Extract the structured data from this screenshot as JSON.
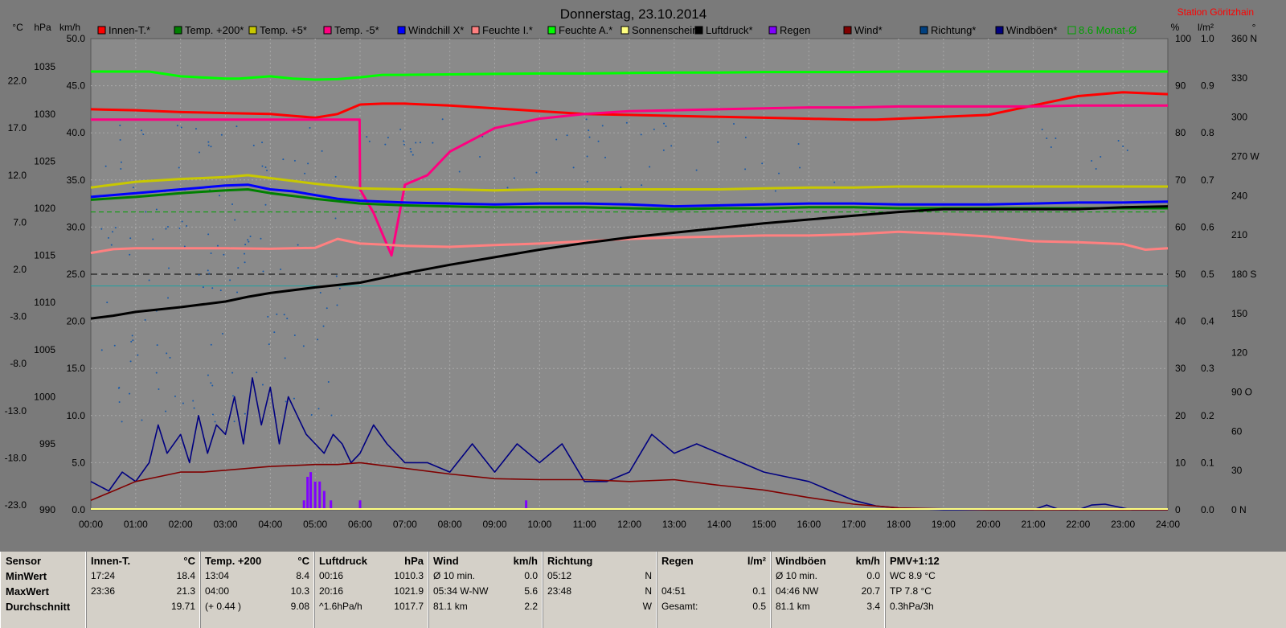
{
  "title": "Donnerstag, 23.10.2014",
  "station": "Station Göritzhain",
  "unit_headers_left": [
    "°C",
    "hPa",
    "km/h"
  ],
  "unit_headers_right": [
    "%",
    "l/m²",
    "°"
  ],
  "legend": [
    {
      "label": "Innen-T.*",
      "color": "#ff0000"
    },
    {
      "label": "Temp. +200*",
      "color": "#008000"
    },
    {
      "label": "Temp. +5*",
      "color": "#c8c800"
    },
    {
      "label": "Temp. -5*",
      "color": "#ff0080"
    },
    {
      "label": "Windchill X*",
      "color": "#0000ff"
    },
    {
      "label": "Feuchte I.*",
      "color": "#ff8080"
    },
    {
      "label": "Feuchte A.*",
      "color": "#00ff00"
    },
    {
      "label": "Sonnenschein",
      "color": "#ffff80"
    },
    {
      "label": "Luftdruck*",
      "color": "#000000"
    },
    {
      "label": "Regen",
      "color": "#8000ff"
    },
    {
      "label": "Wind*",
      "color": "#800000"
    },
    {
      "label": "Richtung*",
      "color": "#004080"
    },
    {
      "label": "Windböen*",
      "color": "#000080"
    },
    {
      "label": "8.6 Monat-Ø",
      "color": "#00a000",
      "hollow": true
    }
  ],
  "chart_data": {
    "type": "line",
    "title": "Donnerstag, 23.10.2014",
    "x_ticks": [
      "00:00",
      "01:00",
      "02:00",
      "03:00",
      "04:00",
      "05:00",
      "06:00",
      "07:00",
      "08:00",
      "09:00",
      "10:00",
      "11:00",
      "12:00",
      "13:00",
      "14:00",
      "15:00",
      "16:00",
      "17:00",
      "18:00",
      "19:00",
      "20:00",
      "21:00",
      "22:00",
      "23:00",
      "24:00"
    ],
    "axes": {
      "temp_c": [
        "22.0",
        "17.0",
        "12.0",
        "7.0",
        "2.0",
        "-3.0",
        "-8.0",
        "-13.0",
        "-18.0",
        "-23.0"
      ],
      "pressure_hpa": [
        "1035",
        "1030",
        "1025",
        "1020",
        "1015",
        "1010",
        "1005",
        "1000",
        "995",
        "990"
      ],
      "wind_kmh": [
        "50.0",
        "45.0",
        "40.0",
        "35.0",
        "30.0",
        "25.0",
        "20.0",
        "15.0",
        "10.0",
        "5.0",
        "0.0"
      ],
      "humidity_pct": [
        "100",
        "90",
        "80",
        "70",
        "60",
        "50",
        "40",
        "30",
        "20",
        "10",
        "0"
      ],
      "rain_lm2": [
        "1.0",
        "0.9",
        "0.8",
        "0.7",
        "0.6",
        "0.5",
        "0.4",
        "0.3",
        "0.2",
        "0.1",
        "0.0"
      ],
      "direction_deg": [
        "360 N",
        "330",
        "300",
        "270 W",
        "240",
        "210",
        "180 S",
        "150",
        "120",
        "90 O",
        "60",
        "30",
        "0 N"
      ]
    },
    "ylim_wind": [
      0,
      50
    ],
    "series": [
      {
        "name": "Innen-T.*",
        "color": "#ff0000",
        "axis": "temp",
        "x": [
          0,
          1,
          2,
          3,
          4,
          4.5,
          5,
          5.5,
          6,
          6.5,
          7,
          8,
          9,
          10,
          11,
          12,
          13,
          14,
          15,
          16,
          17,
          17.5,
          18,
          19,
          20,
          21,
          22,
          23,
          24
        ],
        "y": [
          19.5,
          19.4,
          19.2,
          19.1,
          19.0,
          18.8,
          18.6,
          19.0,
          20.0,
          20.1,
          20.1,
          19.9,
          19.6,
          19.3,
          19.0,
          18.9,
          18.8,
          18.7,
          18.6,
          18.5,
          18.4,
          18.4,
          18.5,
          18.7,
          18.9,
          19.9,
          20.9,
          21.3,
          21.1
        ]
      },
      {
        "name": "Temp. -5*",
        "color": "#ff0080",
        "axis": "temp",
        "x": [
          0,
          1,
          2,
          3,
          4,
          5,
          5.99,
          6,
          6.3,
          6.7,
          7,
          7.5,
          8,
          9,
          10,
          11,
          12,
          13,
          14,
          15,
          16,
          17,
          18,
          19,
          20,
          21,
          22,
          23,
          24
        ],
        "y": [
          18.4,
          18.4,
          18.4,
          18.4,
          18.4,
          18.4,
          18.4,
          11.0,
          8.5,
          4.0,
          11.5,
          12.5,
          15.0,
          17.5,
          18.5,
          19.0,
          19.3,
          19.4,
          19.5,
          19.6,
          19.7,
          19.7,
          19.8,
          19.8,
          19.8,
          19.8,
          19.9,
          19.9,
          19.9
        ]
      },
      {
        "name": "Feuchte A.*",
        "color": "#00ff00",
        "axis": "hum",
        "x": [
          0,
          1,
          1.3,
          2,
          3,
          3.3,
          4,
          4.5,
          5,
          5.5,
          6,
          6.5,
          7,
          8,
          9,
          10,
          11,
          12,
          13,
          14,
          15,
          16,
          17,
          18,
          19,
          20,
          21,
          22,
          23,
          24
        ],
        "y": [
          93,
          93,
          93,
          92,
          91.5,
          91.5,
          92,
          91.5,
          91.3,
          91.4,
          91.8,
          92.3,
          92.3,
          92.4,
          92.5,
          92.6,
          92.6,
          92.7,
          92.8,
          92.8,
          92.9,
          92.9,
          92.9,
          93,
          93,
          93,
          93,
          93,
          93,
          93
        ]
      },
      {
        "name": "Temp. +5*",
        "color": "#c8c800",
        "axis": "wind",
        "x": [
          0,
          1,
          2,
          3,
          3.5,
          4,
          5,
          6,
          7,
          8,
          9,
          10,
          11,
          12,
          13,
          14,
          15,
          16,
          17,
          18,
          19,
          20,
          21,
          22,
          23,
          24
        ],
        "y": [
          34.2,
          34.8,
          35.1,
          35.3,
          35.5,
          35.2,
          34.6,
          34.1,
          34.0,
          34.0,
          33.9,
          34.0,
          34.0,
          34.0,
          34.0,
          34.0,
          34.1,
          34.2,
          34.2,
          34.3,
          34.3,
          34.3,
          34.3,
          34.3,
          34.3,
          34.3
        ]
      },
      {
        "name": "Windchill X*",
        "color": "#0000ff",
        "axis": "wind",
        "x": [
          0,
          1,
          2,
          3,
          3.5,
          4,
          4.5,
          5,
          5.5,
          6,
          7,
          8,
          9,
          10,
          11,
          12,
          13,
          14,
          15,
          16,
          17,
          18,
          19,
          20,
          21,
          22,
          23,
          24
        ],
        "y": [
          33.2,
          33.6,
          34.0,
          34.4,
          34.5,
          34.0,
          33.8,
          33.4,
          33.0,
          32.8,
          32.6,
          32.5,
          32.4,
          32.5,
          32.5,
          32.4,
          32.2,
          32.3,
          32.4,
          32.5,
          32.5,
          32.4,
          32.4,
          32.4,
          32.5,
          32.6,
          32.6,
          32.7
        ]
      },
      {
        "name": "Temp. +200*",
        "color": "#008000",
        "axis": "wind",
        "x": [
          0,
          1,
          2,
          3,
          3.5,
          4,
          5,
          6,
          7,
          8,
          9,
          10,
          11,
          12,
          13,
          14,
          15,
          16,
          17,
          18,
          19,
          20,
          21,
          22,
          23,
          24
        ],
        "y": [
          32.9,
          33.2,
          33.6,
          33.9,
          34.0,
          33.6,
          33.0,
          32.5,
          32.3,
          32.2,
          32.1,
          32.1,
          32.1,
          32.0,
          31.9,
          32.0,
          32.0,
          32.1,
          32.1,
          32.0,
          32.0,
          32.0,
          32.0,
          32.0,
          32.0,
          32.0
        ]
      },
      {
        "name": "Feuchte I.*",
        "color": "#ff8080",
        "axis": "hum",
        "x": [
          0,
          0.5,
          1,
          2,
          3,
          4,
          5,
          5.5,
          6,
          6.5,
          7,
          8,
          9,
          10,
          11,
          12,
          13,
          14,
          15,
          16,
          17,
          18,
          19,
          20,
          21,
          22,
          23,
          23.5,
          24
        ],
        "y": [
          54.5,
          55.3,
          55.5,
          55.5,
          55.5,
          55.4,
          55.6,
          57.5,
          56.5,
          56.3,
          56.0,
          55.8,
          56.2,
          56.5,
          57.0,
          57.5,
          57.8,
          58,
          58.2,
          58.2,
          58.5,
          59,
          58.6,
          58,
          57,
          56.8,
          56.4,
          55.2,
          55.5
        ]
      },
      {
        "name": "Luftdruck*",
        "color": "#000000",
        "axis": "press",
        "x": [
          0,
          0.5,
          1,
          2,
          3,
          3.5,
          4,
          5,
          6,
          6.5,
          7,
          8,
          9,
          10,
          11,
          12,
          13,
          14,
          15,
          16,
          17,
          18,
          19,
          20,
          21,
          22,
          23,
          24
        ],
        "y": [
          1010.3,
          1010.6,
          1011.0,
          1011.5,
          1012.1,
          1012.6,
          1013.0,
          1013.6,
          1014.1,
          1014.6,
          1015.1,
          1016.0,
          1016.8,
          1017.6,
          1018.3,
          1018.9,
          1019.4,
          1019.9,
          1020.4,
          1020.8,
          1021.2,
          1021.6,
          1021.9,
          1021.9,
          1021.9,
          1021.9,
          1022.1,
          1022.2
        ]
      },
      {
        "name": "Windböen*",
        "color": "#000080",
        "axis": "wind",
        "x": [
          0,
          0.4,
          0.7,
          1,
          1.3,
          1.5,
          1.7,
          2,
          2.2,
          2.4,
          2.6,
          2.8,
          3,
          3.2,
          3.4,
          3.6,
          3.8,
          4,
          4.2,
          4.4,
          4.6,
          4.8,
          5,
          5.2,
          5.4,
          5.6,
          5.8,
          6,
          6.3,
          6.6,
          7,
          7.5,
          8,
          8.5,
          9,
          9.5,
          10,
          10.5,
          11,
          11.5,
          12,
          12.5,
          13,
          13.5,
          14,
          14.5,
          15,
          15.5,
          16,
          16.5,
          17,
          17.5,
          18,
          18.5,
          19,
          20,
          20.5,
          21,
          21.3,
          21.6,
          22,
          22.3,
          22.6,
          22.9,
          23.2,
          23.5,
          24
        ],
        "y": [
          3,
          2,
          4,
          3,
          5,
          9,
          6,
          8,
          5,
          10,
          6,
          9,
          8,
          12,
          7,
          14,
          9,
          13,
          7,
          12,
          10,
          8,
          7,
          6,
          8,
          7,
          5,
          6,
          9,
          7,
          5,
          5,
          4,
          7,
          4,
          7,
          5,
          7,
          3,
          3,
          4,
          8,
          6,
          7,
          6,
          5,
          4,
          3.5,
          3,
          2,
          1,
          0.4,
          0.2,
          0.1,
          0,
          0,
          0,
          0,
          0.5,
          0,
          0,
          0.5,
          0.6,
          0.3,
          0,
          0,
          0
        ]
      },
      {
        "name": "Wind*",
        "color": "#800000",
        "axis": "wind",
        "x": [
          0,
          0.5,
          1,
          1.5,
          2,
          2.5,
          3,
          3.5,
          4,
          4.5,
          5,
          5.5,
          6,
          7,
          8,
          9,
          10,
          11,
          12,
          13,
          14,
          15,
          16,
          17,
          18,
          19,
          20,
          21,
          22,
          23,
          24
        ],
        "y": [
          1,
          2,
          3,
          3.5,
          4,
          4,
          4.2,
          4.4,
          4.6,
          4.7,
          4.8,
          4.8,
          5,
          4.4,
          3.8,
          3.3,
          3.2,
          3.2,
          3,
          3.2,
          2.6,
          2.1,
          1.3,
          0.6,
          0.2,
          0.1,
          0,
          0,
          0,
          0,
          0
        ]
      },
      {
        "name": "Regen",
        "color": "#8000ff",
        "axis": "rain",
        "type": "bar",
        "x": [
          4.75,
          4.83,
          4.9,
          5.0,
          5.1,
          5.2,
          5.35,
          6.0,
          9.7
        ],
        "y": [
          0.02,
          0.07,
          0.08,
          0.06,
          0.06,
          0.04,
          0.02,
          0.02,
          0.02
        ]
      }
    ]
  },
  "stats": {
    "sensor": {
      "title": "Sensor",
      "rows": [
        "MinWert",
        "MaxWert",
        "Durchschnitt"
      ]
    },
    "innen": {
      "title": "Innen-T.",
      "unit": "°C",
      "rows": [
        [
          "17:24",
          "18.4"
        ],
        [
          "23:36",
          "21.3"
        ],
        [
          "",
          "19.71"
        ]
      ]
    },
    "temp200": {
      "title": "Temp. +200",
      "unit": "°C",
      "rows": [
        [
          "13:04",
          "8.4"
        ],
        [
          "04:00",
          "10.3"
        ],
        [
          "(+ 0.44 )",
          "9.08"
        ]
      ]
    },
    "druck": {
      "title": "Luftdruck",
      "unit": "hPa",
      "rows": [
        [
          "00:16",
          "1010.3"
        ],
        [
          "20:16",
          "1021.9"
        ],
        [
          "^1.6hPa/h",
          "1017.7"
        ]
      ]
    },
    "wind": {
      "title": "Wind",
      "unit": "km/h",
      "rows": [
        [
          "Ø 10 min.",
          "0.0"
        ],
        [
          "05:34 W-NW",
          "5.6"
        ],
        [
          "81.1 km",
          "2.2"
        ]
      ]
    },
    "richtung": {
      "title": "Richtung",
      "unit": "",
      "rows": [
        [
          "05:12",
          "N"
        ],
        [
          "23:48",
          "N"
        ],
        [
          "",
          "W"
        ]
      ]
    },
    "regen": {
      "title": "Regen",
      "unit": "l/m²",
      "rows": [
        [
          "",
          ""
        ],
        [
          "04:51",
          "0.1"
        ],
        [
          "Gesamt:",
          "0.5"
        ]
      ]
    },
    "boeen": {
      "title": "Windböen",
      "unit": "km/h",
      "rows": [
        [
          "Ø 10 min.",
          "0.0"
        ],
        [
          "04:46 NW",
          "20.7"
        ],
        [
          "81.1 km",
          "3.4"
        ]
      ]
    },
    "pmv": {
      "title": "PMV+1:12",
      "rows": [
        "WC 8.9 °C",
        "TP 7.8 °C",
        "0.3hPa/3h"
      ]
    }
  }
}
